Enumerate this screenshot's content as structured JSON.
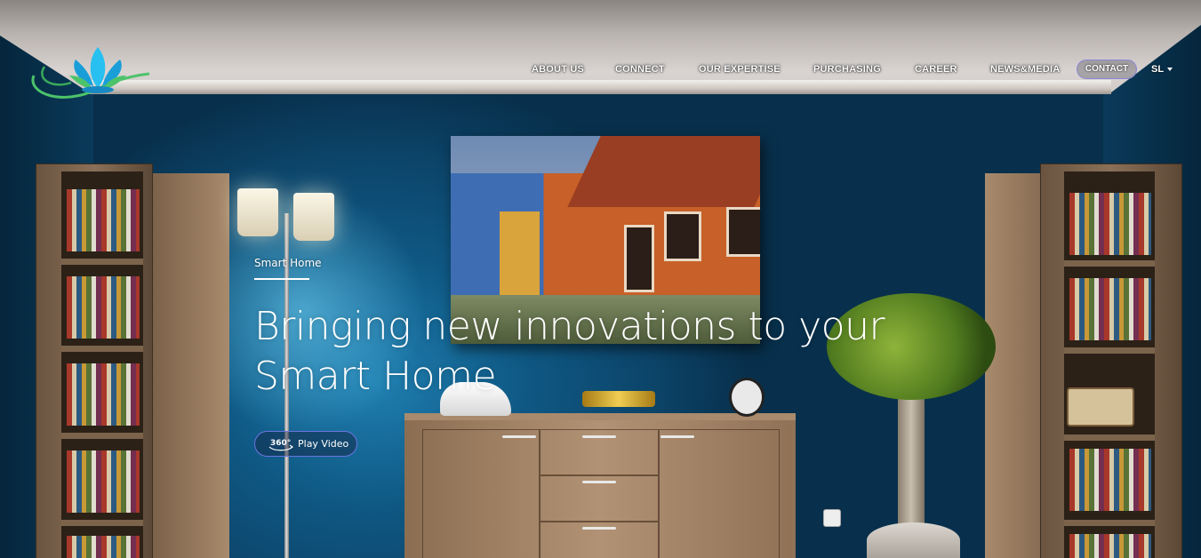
{
  "nav": {
    "items": [
      {
        "label": "ABOUT US"
      },
      {
        "label": "CONNECT"
      },
      {
        "label": "OUR EXPERTISE"
      },
      {
        "label": "PURCHASING"
      },
      {
        "label": "CAREER"
      },
      {
        "label": "NEWS&MEDIA"
      }
    ],
    "contact_label": "CONTACT",
    "language": "SL"
  },
  "logo": {
    "icon": "lotus-logo-icon",
    "colors": [
      "#1a9ed8",
      "#4cc36a"
    ]
  },
  "hero": {
    "eyebrow": "Smart Home",
    "headline_line1": "Bringing new innovations to your",
    "headline_line2": "Smart Home",
    "play_icon_text": "360°",
    "play_label": "Play Video",
    "accent_color": "#6c75e0"
  }
}
